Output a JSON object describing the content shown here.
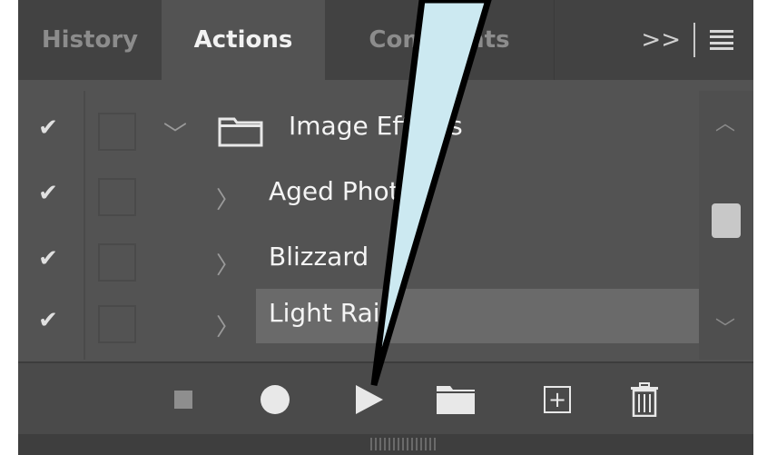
{
  "tabs": [
    {
      "label": "History",
      "active": false
    },
    {
      "label": "Actions",
      "active": true
    },
    {
      "label": "Comments",
      "active": false
    }
  ],
  "tabbar_icons": {
    "overflow": "double-chevron-right-icon",
    "menu": "hamburger-menu-icon"
  },
  "tabbar_overflow_glyph": ">>",
  "actions": [
    {
      "label": "Image Effects",
      "type": "set",
      "expanded": true,
      "checked": true,
      "selected": false
    },
    {
      "label": "Aged Photo",
      "type": "action",
      "expanded": false,
      "checked": true,
      "selected": false
    },
    {
      "label": "Blizzard",
      "type": "action",
      "expanded": false,
      "checked": true,
      "selected": false
    },
    {
      "label": "Light Rain",
      "type": "action",
      "expanded": false,
      "checked": true,
      "selected": true
    }
  ],
  "glyphs": {
    "check": "✔",
    "chevron_right": "〉",
    "chevron_down": "﹀",
    "scroll_up": "︿",
    "scroll_down": "﹀",
    "plus": "+"
  },
  "footer_buttons": [
    {
      "icon": "stop-icon"
    },
    {
      "icon": "record-icon"
    },
    {
      "icon": "play-icon"
    },
    {
      "icon": "new-set-folder-icon"
    },
    {
      "icon": "new-action-icon"
    },
    {
      "icon": "trash-icon"
    }
  ],
  "colors": {
    "panel": "#535353",
    "tabbar": "#424242",
    "selected_row": "#6a6a6a",
    "callout_fill": "#cce9f1",
    "callout_stroke": "#000000"
  }
}
